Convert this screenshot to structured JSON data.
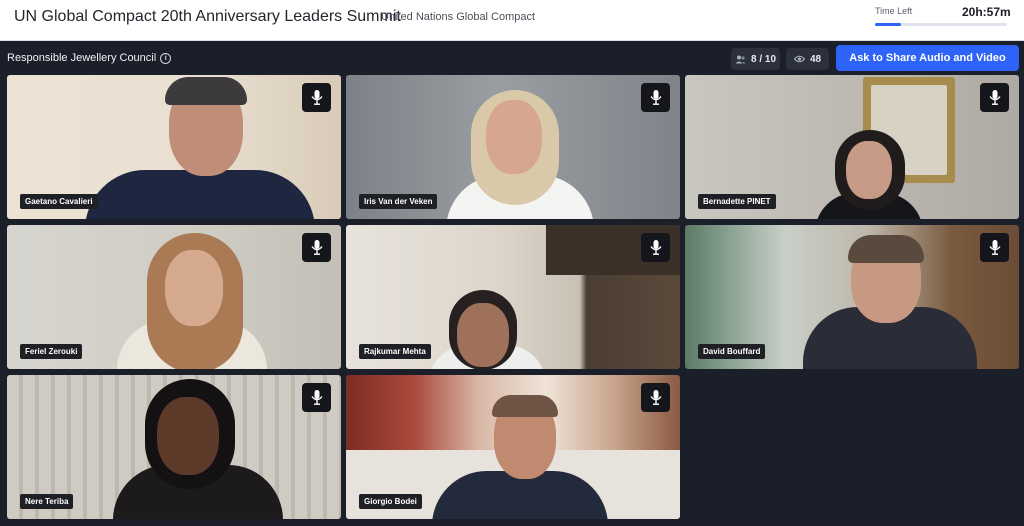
{
  "header": {
    "event_title": "UN Global Compact 20th Anniversary Leaders Summit",
    "organization": "United Nations Global Compact",
    "time_left_label": "Time Left",
    "time_left_value": "20h:57m",
    "time_progress": 0.2
  },
  "room": {
    "name": "Responsible Jewellery Council",
    "participants": "8 / 10",
    "viewers": "48",
    "share_button": "Ask to Share Audio and Video"
  },
  "participants": [
    {
      "name": "Gaetano Cavalieri"
    },
    {
      "name": "Iris Van der Veken"
    },
    {
      "name": "Bernadette PINET"
    },
    {
      "name": "Feriel Zerouki"
    },
    {
      "name": "Rajkumar Mehta"
    },
    {
      "name": "David Bouffard"
    },
    {
      "name": "Nere Teriba"
    },
    {
      "name": "Giorgio Bodei"
    }
  ],
  "icons": {
    "mic": "microphone-icon",
    "info": "info-icon",
    "people": "people-icon",
    "eye": "eye-icon"
  },
  "colors": {
    "accent": "#2d63f6",
    "background": "#1b1f29"
  }
}
